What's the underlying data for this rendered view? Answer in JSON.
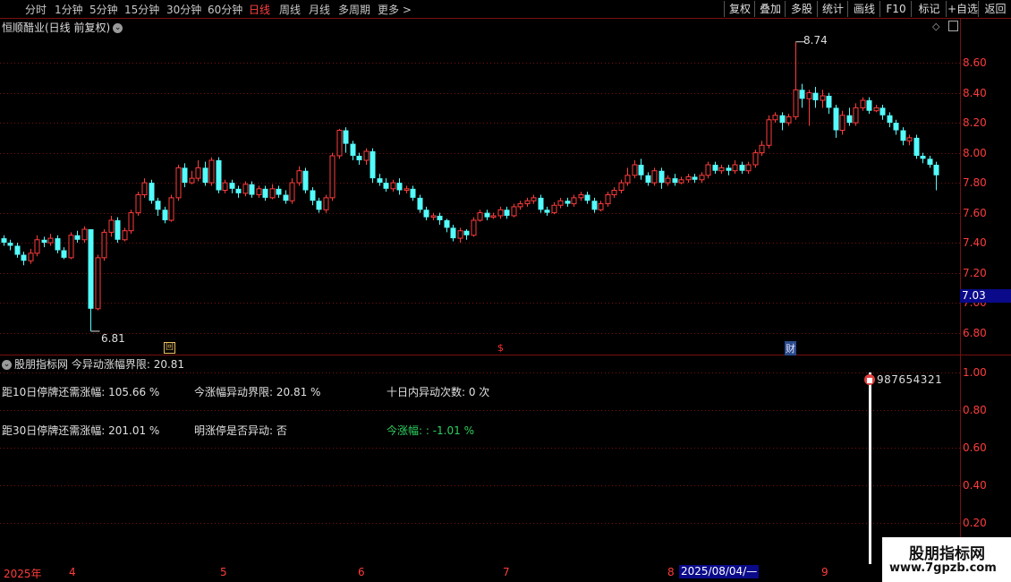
{
  "toolbar": {
    "periods": [
      "分时",
      "1分钟",
      "5分钟",
      "15分钟",
      "30分钟",
      "60分钟",
      "日线",
      "周线",
      "月线",
      "多周期",
      "更多"
    ],
    "active_period": "日线",
    "more_arrow": ">",
    "buttons": [
      "复权",
      "叠加",
      "多股",
      "统计",
      "画线",
      "F10",
      "标记",
      "+自选",
      "返回"
    ]
  },
  "chart_title": "恒顺醋业(日线 前复权)",
  "price_labels": [
    "8.60",
    "8.40",
    "8.20",
    "8.00",
    "7.80",
    "7.60",
    "7.40",
    "7.20",
    "7.00",
    "6.80"
  ],
  "current_price": "7.03",
  "high_label": "8.74",
  "low_label": "6.81",
  "event_markers": [
    {
      "text": "回",
      "color": "#e8c060"
    },
    {
      "text": "$",
      "color": "#ff3030"
    },
    {
      "text": "财",
      "color": "#e0e0ff"
    }
  ],
  "indicator": {
    "header_name": "股朋指标网",
    "header_text": "今异动涨幅界限: 20.81",
    "row1": {
      "a": "距10日停牌还需涨幅: 105.66 %",
      "b": "今涨幅异动界限: 20.81 %",
      "c": "十日内异动次数: 0 次"
    },
    "row2": {
      "a": "距30日停牌还需涨幅: 201.01 %",
      "b": "明涨停是否异动: 否",
      "c": "今涨幅: : -1.01 %"
    },
    "bar_label": "987654321",
    "axis": [
      "1.00",
      "0.80",
      "0.60",
      "0.40",
      "0.20"
    ]
  },
  "date_axis": {
    "year": "2025年",
    "months": [
      "4",
      "5",
      "6",
      "7",
      "8",
      "9"
    ],
    "cursor_date": "2025/08/04/—"
  },
  "watermark": {
    "title": "股朋指标网",
    "url": "www.7gpzb.com"
  },
  "colors": {
    "up": "#ff3c3c",
    "down": "#54fcfc",
    "grid": "#7a1010",
    "green": "#2ed060"
  },
  "chart_data": {
    "type": "candlestick",
    "title": "恒顺醋业(日线 前复权)",
    "y_range": [
      6.72,
      8.78
    ],
    "candles": [
      [
        7.43,
        7.4,
        7.45,
        7.38
      ],
      [
        7.4,
        7.38,
        7.42,
        7.35
      ],
      [
        7.38,
        7.32,
        7.4,
        7.3
      ],
      [
        7.32,
        7.28,
        7.34,
        7.25
      ],
      [
        7.28,
        7.33,
        7.36,
        7.26
      ],
      [
        7.33,
        7.42,
        7.45,
        7.31
      ],
      [
        7.42,
        7.4,
        7.44,
        7.37
      ],
      [
        7.4,
        7.43,
        7.46,
        7.38
      ],
      [
        7.43,
        7.35,
        7.45,
        7.33
      ],
      [
        7.35,
        7.3,
        7.37,
        7.29
      ],
      [
        7.3,
        7.45,
        7.47,
        7.29
      ],
      [
        7.45,
        7.42,
        7.48,
        7.4
      ],
      [
        7.42,
        7.49,
        7.51,
        7.4
      ],
      [
        7.49,
        6.96,
        7.49,
        6.81
      ],
      [
        6.96,
        7.3,
        7.32,
        6.95
      ],
      [
        7.3,
        7.47,
        7.49,
        7.28
      ],
      [
        7.47,
        7.55,
        7.58,
        7.44
      ],
      [
        7.55,
        7.42,
        7.57,
        7.4
      ],
      [
        7.42,
        7.48,
        7.5,
        7.41
      ],
      [
        7.48,
        7.6,
        7.62,
        7.46
      ],
      [
        7.6,
        7.72,
        7.74,
        7.58
      ],
      [
        7.72,
        7.8,
        7.83,
        7.7
      ],
      [
        7.8,
        7.68,
        7.82,
        7.66
      ],
      [
        7.68,
        7.62,
        7.7,
        7.58
      ],
      [
        7.62,
        7.55,
        7.64,
        7.53
      ],
      [
        7.55,
        7.7,
        7.72,
        7.54
      ],
      [
        7.7,
        7.9,
        7.92,
        7.68
      ],
      [
        7.9,
        7.8,
        7.93,
        7.77
      ],
      [
        7.8,
        7.83,
        7.88,
        7.79
      ],
      [
        7.83,
        7.9,
        7.95,
        7.81
      ],
      [
        7.9,
        7.8,
        7.94,
        7.78
      ],
      [
        7.8,
        7.95,
        7.97,
        7.78
      ],
      [
        7.95,
        7.75,
        7.97,
        7.73
      ],
      [
        7.75,
        7.8,
        7.82,
        7.73
      ],
      [
        7.8,
        7.76,
        7.82,
        7.73
      ],
      [
        7.76,
        7.73,
        7.78,
        7.7
      ],
      [
        7.73,
        7.79,
        7.81,
        7.71
      ],
      [
        7.79,
        7.72,
        7.81,
        7.7
      ],
      [
        7.72,
        7.76,
        7.78,
        7.7
      ],
      [
        7.76,
        7.7,
        7.78,
        7.68
      ],
      [
        7.7,
        7.76,
        7.79,
        7.69
      ],
      [
        7.76,
        7.72,
        7.78,
        7.7
      ],
      [
        7.72,
        7.68,
        7.75,
        7.66
      ],
      [
        7.68,
        7.8,
        7.83,
        7.66
      ],
      [
        7.8,
        7.88,
        7.91,
        7.78
      ],
      [
        7.88,
        7.75,
        7.9,
        7.73
      ],
      [
        7.75,
        7.68,
        7.77,
        7.65
      ],
      [
        7.68,
        7.62,
        7.7,
        7.6
      ],
      [
        7.62,
        7.7,
        7.72,
        7.6
      ],
      [
        7.7,
        7.98,
        8.0,
        7.68
      ],
      [
        7.98,
        8.15,
        8.16,
        7.96
      ],
      [
        8.15,
        8.06,
        8.17,
        8.0
      ],
      [
        8.06,
        7.98,
        8.08,
        7.95
      ],
      [
        7.98,
        7.95,
        8.0,
        7.92
      ],
      [
        7.95,
        8.01,
        8.03,
        7.92
      ],
      [
        8.01,
        7.83,
        8.03,
        7.8
      ],
      [
        7.83,
        7.8,
        7.86,
        7.78
      ],
      [
        7.8,
        7.76,
        7.83,
        7.74
      ],
      [
        7.76,
        7.8,
        7.82,
        7.74
      ],
      [
        7.8,
        7.75,
        7.83,
        7.72
      ],
      [
        7.75,
        7.76,
        7.78,
        7.73
      ],
      [
        7.76,
        7.7,
        7.78,
        7.68
      ],
      [
        7.7,
        7.62,
        7.72,
        7.6
      ],
      [
        7.62,
        7.57,
        7.64,
        7.55
      ],
      [
        7.57,
        7.58,
        7.6,
        7.55
      ],
      [
        7.58,
        7.55,
        7.6,
        7.52
      ],
      [
        7.55,
        7.5,
        7.56,
        7.47
      ],
      [
        7.5,
        7.43,
        7.52,
        7.41
      ],
      [
        7.43,
        7.48,
        7.5,
        7.4
      ],
      [
        7.48,
        7.45,
        7.49,
        7.42
      ],
      [
        7.45,
        7.55,
        7.57,
        7.44
      ],
      [
        7.55,
        7.6,
        7.62,
        7.54
      ],
      [
        7.6,
        7.57,
        7.62,
        7.55
      ],
      [
        7.57,
        7.58,
        7.6,
        7.56
      ],
      [
        7.58,
        7.62,
        7.64,
        7.56
      ],
      [
        7.62,
        7.58,
        7.64,
        7.56
      ],
      [
        7.58,
        7.64,
        7.66,
        7.57
      ],
      [
        7.64,
        7.66,
        7.68,
        7.62
      ],
      [
        7.66,
        7.68,
        7.7,
        7.64
      ],
      [
        7.68,
        7.7,
        7.72,
        7.66
      ],
      [
        7.7,
        7.62,
        7.72,
        7.6
      ],
      [
        7.62,
        7.6,
        7.64,
        7.58
      ],
      [
        7.6,
        7.65,
        7.67,
        7.59
      ],
      [
        7.65,
        7.68,
        7.7,
        7.63
      ],
      [
        7.68,
        7.66,
        7.7,
        7.64
      ],
      [
        7.66,
        7.7,
        7.72,
        7.64
      ],
      [
        7.7,
        7.72,
        7.74,
        7.68
      ],
      [
        7.72,
        7.68,
        7.74,
        7.66
      ],
      [
        7.68,
        7.62,
        7.7,
        7.6
      ],
      [
        7.62,
        7.66,
        7.68,
        7.61
      ],
      [
        7.66,
        7.72,
        7.74,
        7.64
      ],
      [
        7.72,
        7.75,
        7.77,
        7.7
      ],
      [
        7.75,
        7.8,
        7.82,
        7.73
      ],
      [
        7.8,
        7.85,
        7.9,
        7.78
      ],
      [
        7.85,
        7.92,
        7.95,
        7.83
      ],
      [
        7.92,
        7.85,
        7.96,
        7.82
      ],
      [
        7.85,
        7.8,
        7.87,
        7.78
      ],
      [
        7.8,
        7.88,
        7.9,
        7.78
      ],
      [
        7.88,
        7.8,
        7.9,
        7.76
      ],
      [
        7.8,
        7.83,
        7.85,
        7.78
      ],
      [
        7.83,
        7.8,
        7.86,
        7.78
      ],
      [
        7.8,
        7.82,
        7.84,
        7.79
      ],
      [
        7.82,
        7.84,
        7.86,
        7.8
      ],
      [
        7.84,
        7.82,
        7.86,
        7.8
      ],
      [
        7.82,
        7.85,
        7.87,
        7.8
      ],
      [
        7.85,
        7.92,
        7.94,
        7.83
      ],
      [
        7.92,
        7.88,
        7.94,
        7.86
      ],
      [
        7.88,
        7.9,
        7.92,
        7.86
      ],
      [
        7.9,
        7.88,
        7.92,
        7.85
      ],
      [
        7.88,
        7.92,
        7.95,
        7.86
      ],
      [
        7.92,
        7.88,
        7.94,
        7.86
      ],
      [
        7.88,
        7.92,
        7.94,
        7.86
      ],
      [
        7.92,
        8.0,
        8.02,
        7.9
      ],
      [
        8.0,
        8.05,
        8.08,
        7.98
      ],
      [
        8.05,
        8.22,
        8.25,
        8.03
      ],
      [
        8.22,
        8.25,
        8.27,
        8.2
      ],
      [
        8.25,
        8.2,
        8.27,
        8.15
      ],
      [
        8.2,
        8.24,
        8.26,
        8.18
      ],
      [
        8.24,
        8.42,
        8.74,
        8.22
      ],
      [
        8.42,
        8.36,
        8.46,
        8.3
      ],
      [
        8.36,
        8.4,
        8.42,
        8.18
      ],
      [
        8.4,
        8.35,
        8.44,
        8.3
      ],
      [
        8.35,
        8.38,
        8.42,
        8.3
      ],
      [
        8.38,
        8.3,
        8.4,
        8.26
      ],
      [
        8.3,
        8.15,
        8.32,
        8.1
      ],
      [
        8.15,
        8.25,
        8.28,
        8.12
      ],
      [
        8.25,
        8.2,
        8.3,
        8.18
      ],
      [
        8.2,
        8.3,
        8.33,
        8.18
      ],
      [
        8.3,
        8.35,
        8.37,
        8.28
      ],
      [
        8.35,
        8.28,
        8.37,
        8.26
      ],
      [
        8.28,
        8.3,
        8.32,
        8.27
      ],
      [
        8.3,
        8.25,
        8.32,
        8.22
      ],
      [
        8.25,
        8.2,
        8.27,
        8.17
      ],
      [
        8.2,
        8.15,
        8.22,
        8.12
      ],
      [
        8.15,
        8.08,
        8.17,
        8.05
      ],
      [
        8.08,
        8.1,
        8.12,
        8.05
      ],
      [
        8.1,
        7.98,
        8.12,
        7.96
      ],
      [
        7.98,
        7.96,
        8.0,
        7.93
      ],
      [
        7.96,
        7.92,
        7.98,
        7.9
      ],
      [
        7.92,
        7.85,
        7.94,
        7.75
      ]
    ]
  }
}
